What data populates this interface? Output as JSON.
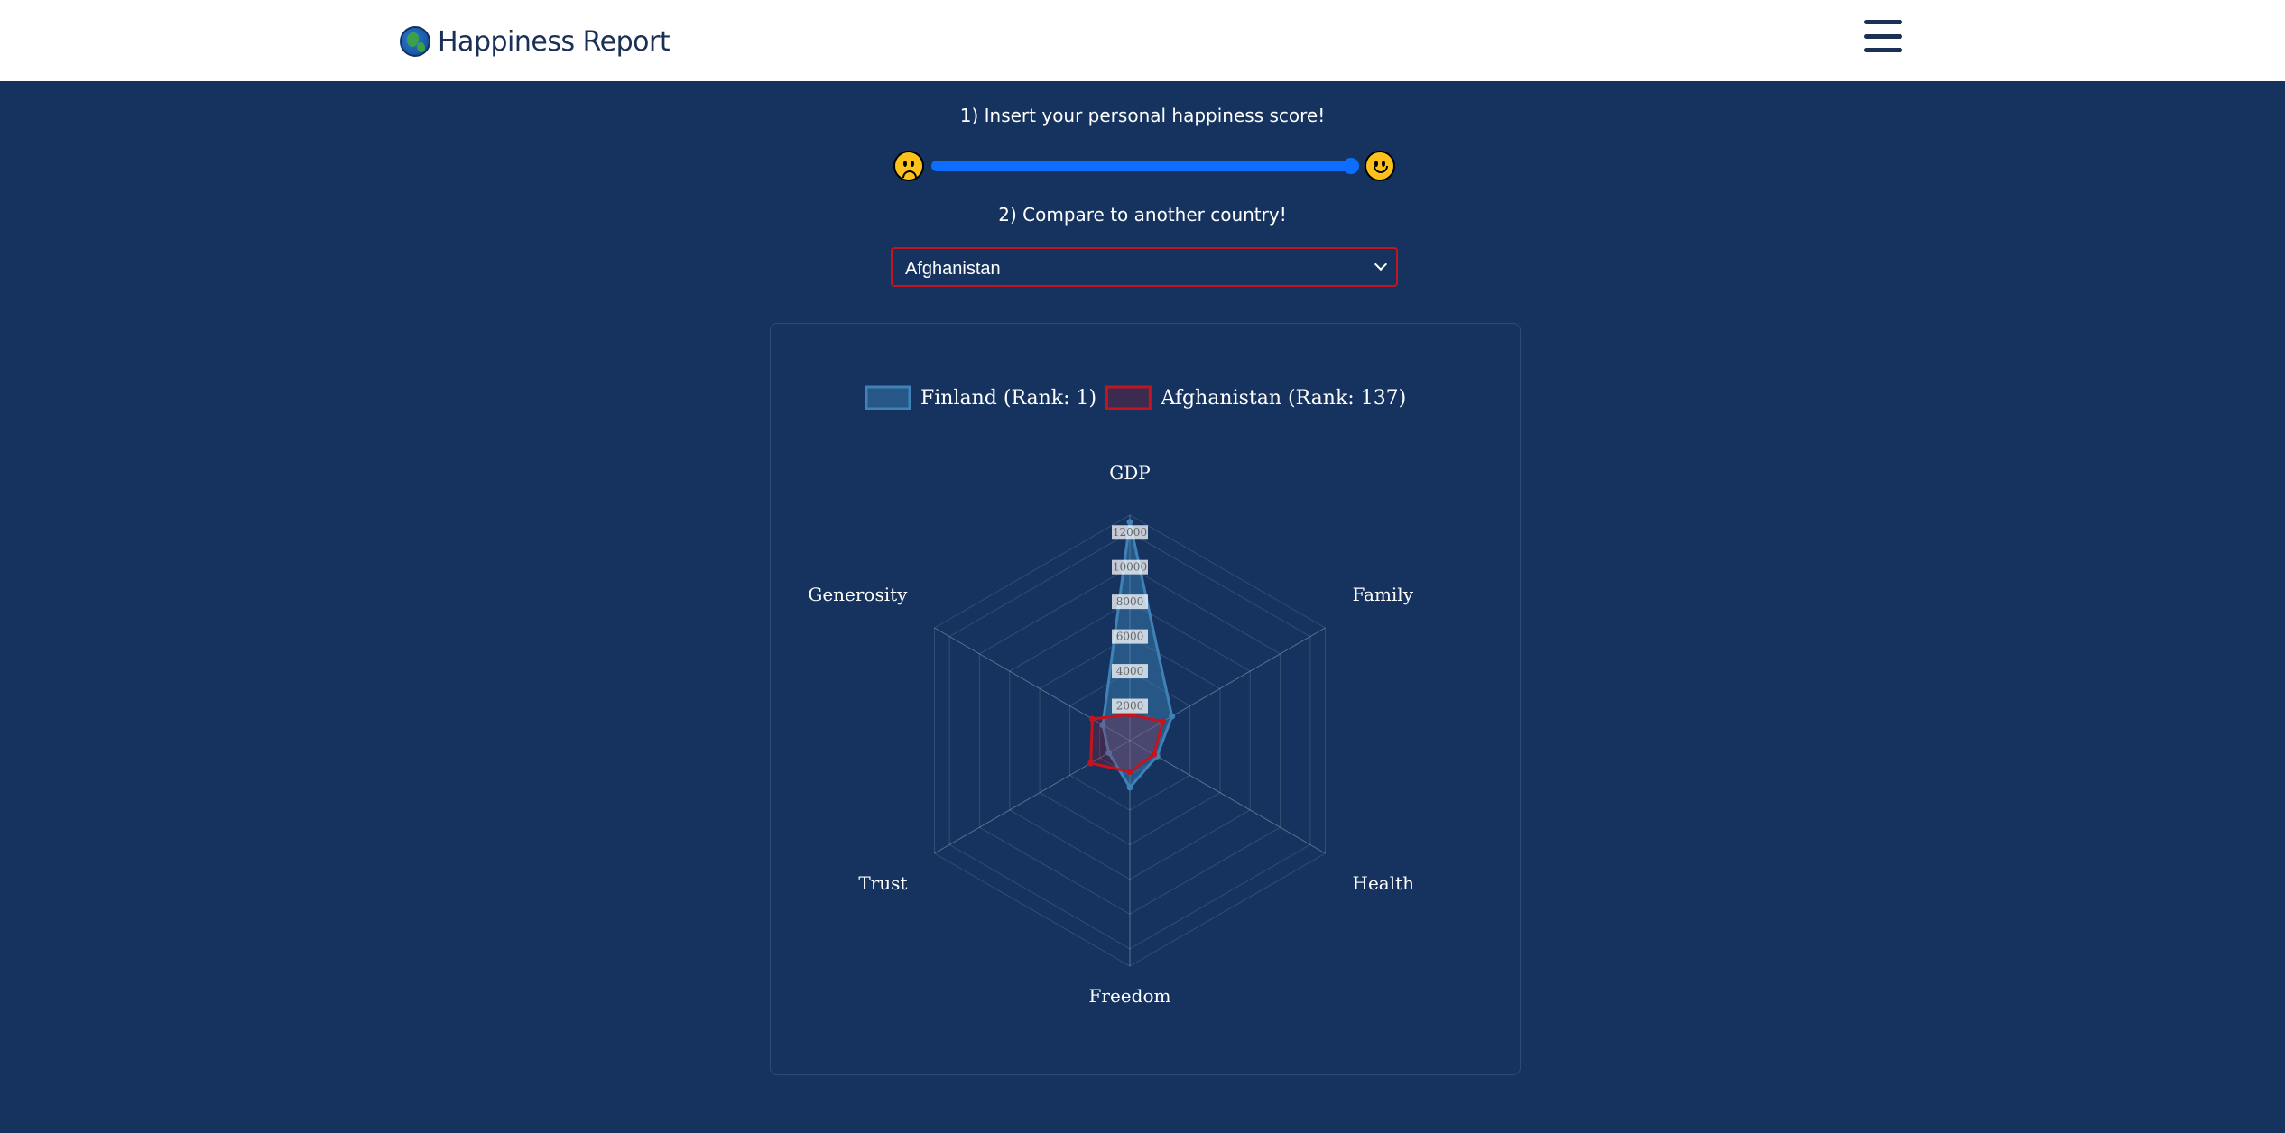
{
  "navbar": {
    "brand": "Happiness Report",
    "brand_icon": "globe-icon",
    "menu_icon": "hamburger-menu-icon"
  },
  "controls": {
    "step1_label": "1) Insert your personal happiness score!",
    "slider_value_fraction": 1.0,
    "sad_icon": "sad-face-icon",
    "happy_icon": "happy-face-icon",
    "step2_label": "2) Compare to another country!",
    "selected_country": "Afghanistan"
  },
  "colors": {
    "background": "#15335e",
    "accent": "#0d6efd",
    "series1": "#3e82b8",
    "series2": "#c4141e"
  },
  "chart_data": {
    "type": "radar",
    "categories": [
      "GDP",
      "Family",
      "Health",
      "Freedom",
      "Trust",
      "Generosity"
    ],
    "r_ticks": [
      2000,
      4000,
      6000,
      8000,
      10000,
      12000
    ],
    "r_range": [
      0,
      13000
    ],
    "legend_position": "top",
    "series": [
      {
        "name": "Finland (Rank: 1)",
        "values": [
          12600,
          2800,
          1800,
          2700,
          1400,
          1800
        ]
      },
      {
        "name": "Afghanistan (Rank: 137)",
        "values": [
          1500,
          2200,
          1600,
          1800,
          2600,
          2500
        ]
      }
    ]
  }
}
